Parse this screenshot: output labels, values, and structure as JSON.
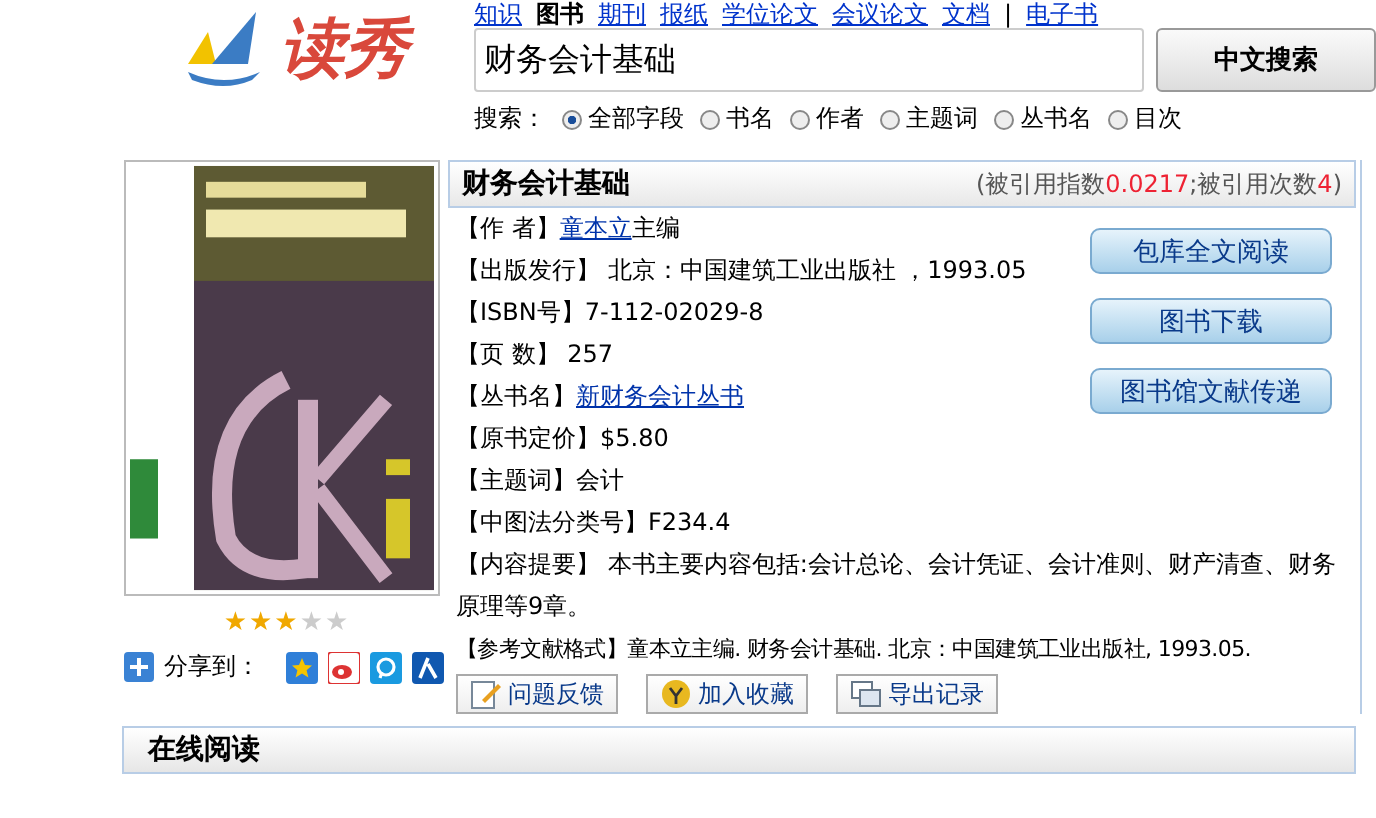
{
  "logo": {
    "text": "读秀"
  },
  "nav": [
    {
      "label": "知识",
      "selected": false
    },
    {
      "label": "图书",
      "selected": true
    },
    {
      "label": "期刊",
      "selected": false
    },
    {
      "label": "报纸",
      "selected": false
    },
    {
      "label": "学位论文",
      "selected": false
    },
    {
      "label": "会议论文",
      "selected": false
    },
    {
      "label": "文档",
      "selected": false
    },
    {
      "label": "电子书",
      "selected": false
    }
  ],
  "nav_separator": "|",
  "search": {
    "value": "财务会计基础",
    "button": "中文搜索",
    "scope_label": "搜索：",
    "scopes": [
      {
        "label": "全部字段",
        "selected": true
      },
      {
        "label": "书名",
        "selected": false
      },
      {
        "label": "作者",
        "selected": false
      },
      {
        "label": "主题词",
        "selected": false
      },
      {
        "label": "丛书名",
        "selected": false
      },
      {
        "label": "目次",
        "selected": false
      }
    ]
  },
  "book": {
    "stars": 3,
    "share_label": "分享到：",
    "title": "财务会计基础",
    "cite_prefix": "(被引用指数",
    "cite_index": "0.0217",
    "cite_mid": ";被引用次数",
    "cite_count": "4",
    "cite_suffix": ")",
    "fields": [
      {
        "label": "【作 者】",
        "link": "童本立",
        "value": "主编"
      },
      {
        "label": "【出版发行】",
        "value": " 北京：中国建筑工业出版社 ，1993.05"
      },
      {
        "label": "【ISBN号】",
        "value": "7-112-02029-8"
      },
      {
        "label": "【页 数】",
        "value": " 257"
      },
      {
        "label": "【丛书名】",
        "link": "新财务会计丛书"
      },
      {
        "label": "【原书定价】",
        "value": "$5.80"
      },
      {
        "label": "【主题词】",
        "value": "会计"
      },
      {
        "label": "【中图法分类号】",
        "value": "F234.4"
      },
      {
        "text": "【内容提要】 本书主要内容包括:会计总论、会计凭证、会计准则、财产清查、财务原理等9章。"
      },
      {
        "label": "【参考文献格式】",
        "value": "童本立主编. 财务会计基础. 北京：中国建筑工业出版社, 1993.05."
      }
    ],
    "actions": [
      "包库全文阅读",
      "图书下载",
      "图书馆文献传递"
    ],
    "tools": [
      "问题反馈",
      "加入收藏",
      "导出记录"
    ]
  },
  "online": {
    "title": "在线阅读"
  }
}
